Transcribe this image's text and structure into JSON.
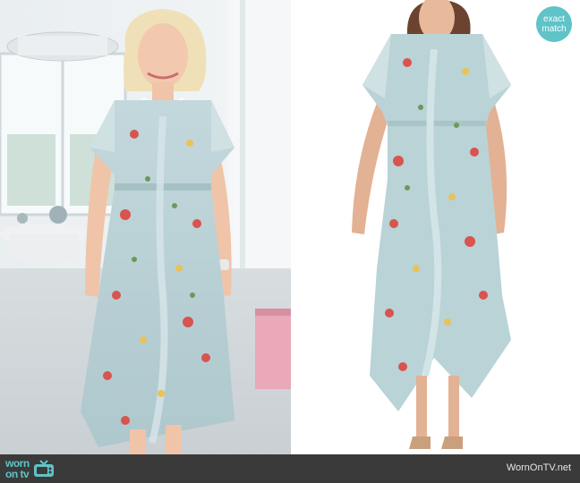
{
  "badge": {
    "line1": "exact",
    "line2": "match"
  },
  "footer": {
    "logo_line1": "worn",
    "logo_line2": "on tv",
    "site_name": "WornOnTV.net"
  },
  "watermark": "wornontv.net",
  "colors": {
    "accent": "#5fc3c7",
    "footer_bg": "#3a3a3a",
    "dress": "#b9d3d6",
    "flower_red": "#d9534f",
    "flower_yellow": "#e8c25a"
  },
  "icons": {
    "logo_tv": "tv-icon"
  }
}
